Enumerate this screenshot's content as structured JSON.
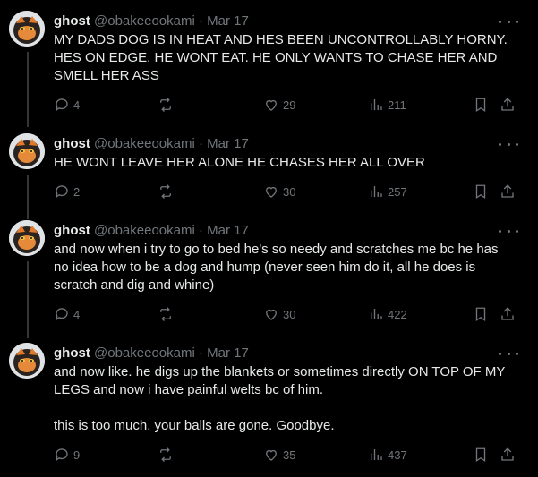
{
  "colors": {
    "background": "#000000",
    "text": "#e7e9ea",
    "muted": "#71767b",
    "thread_line": "#333639"
  },
  "tweets": [
    {
      "display_name": "ghost",
      "handle": "@obakeeookami",
      "separator": "·",
      "date": "Mar 17",
      "text": "MY DADS DOG IS IN HEAT AND HES BEEN UNCONTROLLABLY HORNY.\nHES ON EDGE. HE WONT EAT. HE ONLY WANTS TO CHASE HER AND\nSMELL HER ASS",
      "replies": "4",
      "retweets": "",
      "likes": "29",
      "views": "211"
    },
    {
      "display_name": "ghost",
      "handle": "@obakeeookami",
      "separator": "·",
      "date": "Mar 17",
      "text": "HE WONT LEAVE HER ALONE HE CHASES HER ALL OVER",
      "replies": "2",
      "retweets": "",
      "likes": "30",
      "views": "257"
    },
    {
      "display_name": "ghost",
      "handle": "@obakeeookami",
      "separator": "·",
      "date": "Mar 17",
      "text": "and now when i try to go to bed he's so needy and scratches me bc he has\nno idea how to be a dog and hump (never seen him do it, all he does is\nscratch and dig and whine)",
      "replies": "4",
      "retweets": "",
      "likes": "30",
      "views": "422"
    },
    {
      "display_name": "ghost",
      "handle": "@obakeeookami",
      "separator": "·",
      "date": "Mar 17",
      "text": "and now like. he digs up the blankets or sometimes directly ON TOP OF MY\nLEGS and now i have painful welts bc of him.\n\nthis is too much. your balls are gone. Goodbye.",
      "replies": "9",
      "retweets": "",
      "likes": "35",
      "views": "437"
    }
  ]
}
